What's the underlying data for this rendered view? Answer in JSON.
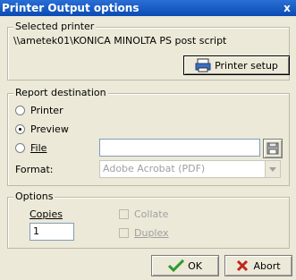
{
  "window": {
    "title": "Printer Output options",
    "close_glyph": "x"
  },
  "selected_printer": {
    "legend": "Selected printer",
    "name": "\\\\ametek01\\KONICA MINOLTA PS post script",
    "setup_button": "Printer setup"
  },
  "report_destination": {
    "legend": "Report destination",
    "options": [
      {
        "label": "Printer",
        "selected": false
      },
      {
        "label": "Preview",
        "selected": true
      },
      {
        "label": "File",
        "selected": false
      }
    ],
    "file_value": "",
    "format_label": "Format:",
    "format_value": "Adobe Acrobat (PDF)"
  },
  "options": {
    "legend": "Options",
    "copies_label": "Copies",
    "copies_value": "1",
    "collate_label": "Collate",
    "duplex_label": "Duplex"
  },
  "buttons": {
    "ok": "OK",
    "abort": "Abort"
  },
  "colors": {
    "title_bar": "#0b4bb3",
    "ok_check": "#2e9a2e",
    "abort_x": "#c0261c"
  }
}
